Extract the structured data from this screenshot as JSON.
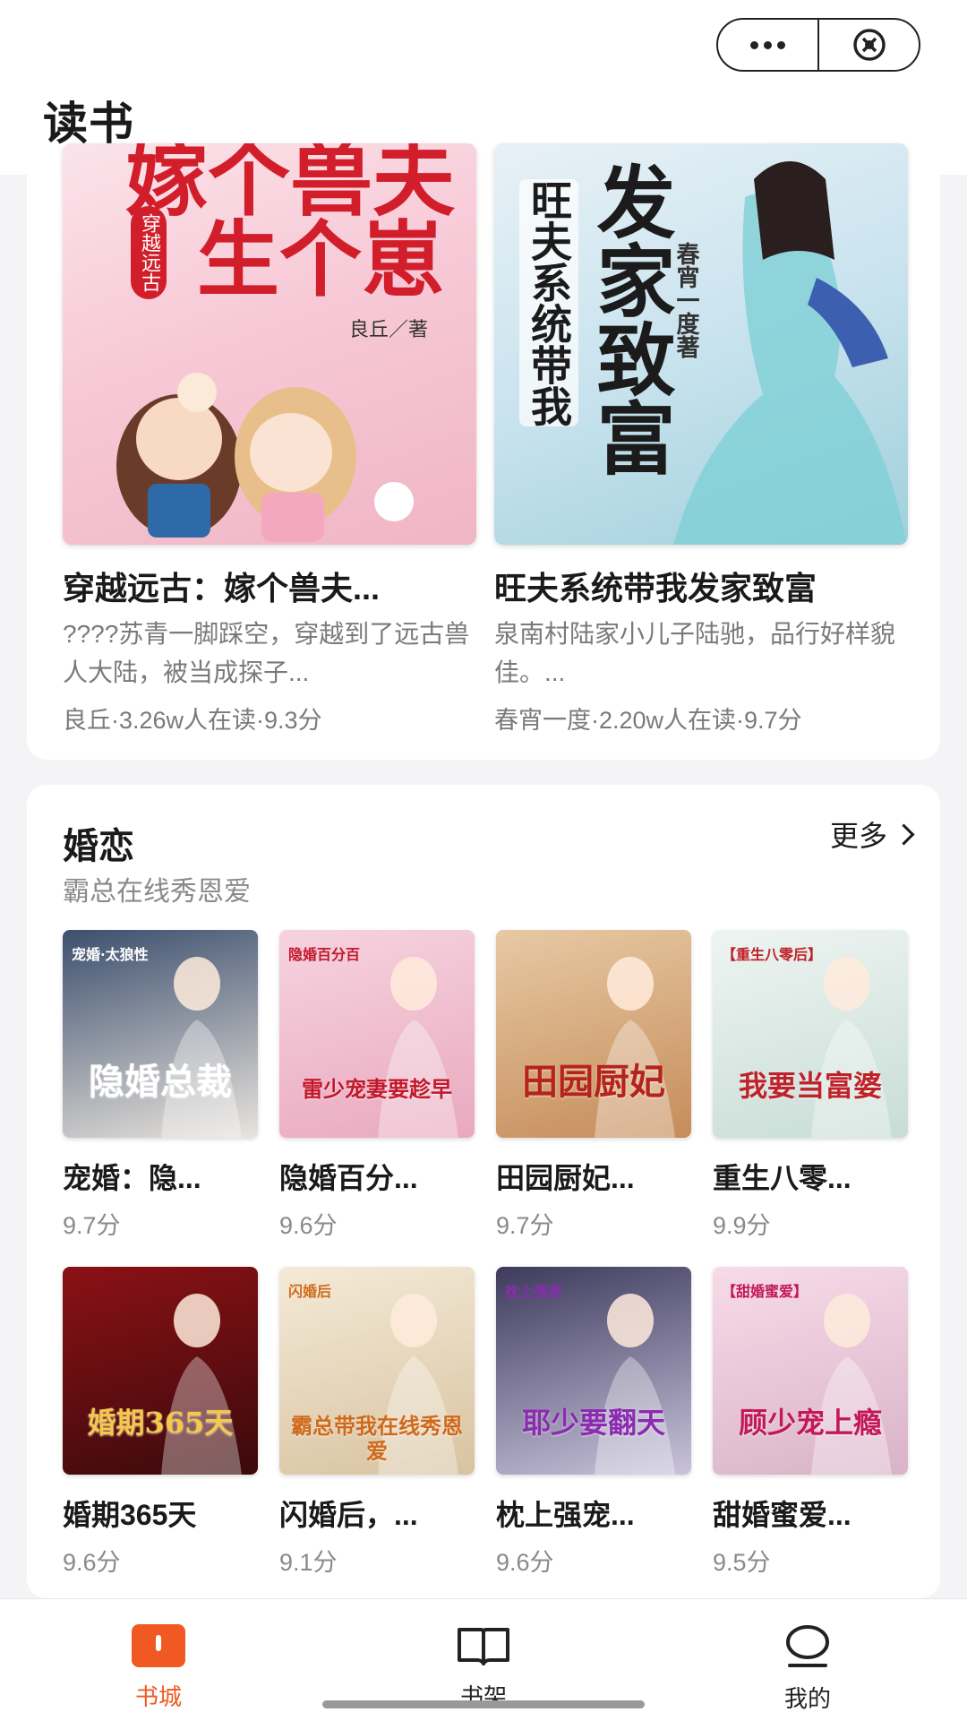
{
  "header": {
    "title": "读书"
  },
  "featured": [
    {
      "title": "穿越远古：嫁个兽夫...",
      "desc": "????苏青一脚踩空，穿越到了远古兽人大陆，被当成探子...",
      "meta": "良丘·3.26w人在读·9.3分",
      "cover_tag": "穿越远古",
      "cover_title": "嫁个兽夫生个崽",
      "cover_author": "良丘／著"
    },
    {
      "title": "旺夫系统带我发家致富",
      "desc": "泉南村陆家小儿子陆驰，品行好样貌佳。...",
      "meta": "春宵一度·2.20w人在读·9.7分",
      "cover_tag": "旺夫系统带我",
      "cover_title": "发家致富",
      "cover_author": "春宵一度著"
    }
  ],
  "romance": {
    "title": "婚恋",
    "subtitle": "霸总在线秀恩爱",
    "more_label": "更多",
    "books": [
      {
        "name": "宠婚：隐...",
        "score": "9.7分",
        "cover_text": "隐婚总裁",
        "cover_sub": "宠婚·太狼性",
        "c1": "#3c4f6e",
        "c2": "#e9e4dd",
        "tc": "#ffffff"
      },
      {
        "name": "隐婚百分...",
        "score": "9.6分",
        "cover_text": "雷少宠妻要趁早",
        "cover_sub": "隐婚百分百",
        "c1": "#f6d3df",
        "c2": "#e9a9be",
        "tc": "#c3172b"
      },
      {
        "name": "田园厨妃...",
        "score": "9.7分",
        "cover_text": "田园厨妃",
        "cover_sub": "",
        "c1": "#e7c9a4",
        "c2": "#c68c5a",
        "tc": "#b5231b"
      },
      {
        "name": "重生八零...",
        "score": "9.9分",
        "cover_text": "我要当富婆",
        "cover_sub": "【重生八零后】",
        "c1": "#eef4f1",
        "c2": "#c8ddd6",
        "tc": "#c0222a"
      },
      {
        "name": "婚期365天",
        "score": "9.6分",
        "cover_text": "婚期365天",
        "cover_sub": "",
        "c1": "#8b1115",
        "c2": "#3a0a0c",
        "tc": "#f5c84a"
      },
      {
        "name": "闪婚后，...",
        "score": "9.1分",
        "cover_text": "霸总带我在线秀恩爱",
        "cover_sub": "闪婚后",
        "c1": "#f4ead8",
        "c2": "#d8c3a0",
        "tc": "#d06a1b"
      },
      {
        "name": "枕上强宠...",
        "score": "9.6分",
        "cover_text": "耶少要翻天",
        "cover_sub": "枕上强宠",
        "c1": "#3d3a5c",
        "c2": "#c9c3dc",
        "tc": "#8a2bb0"
      },
      {
        "name": "甜婚蜜爱...",
        "score": "9.5分",
        "cover_text": "顾少宠上瘾",
        "cover_sub": "【甜婚蜜爱】",
        "c1": "#f7dbe7",
        "c2": "#d9b3c9",
        "tc": "#c2185b"
      }
    ]
  },
  "tabs": [
    {
      "label": "书城",
      "icon": "bookstore-icon",
      "active": true
    },
    {
      "label": "书架",
      "icon": "bookshelf-icon",
      "active": false
    },
    {
      "label": "我的",
      "icon": "profile-icon",
      "active": false
    }
  ],
  "colors": {
    "accent": "#f05a22",
    "background": "#f4f4f6"
  }
}
